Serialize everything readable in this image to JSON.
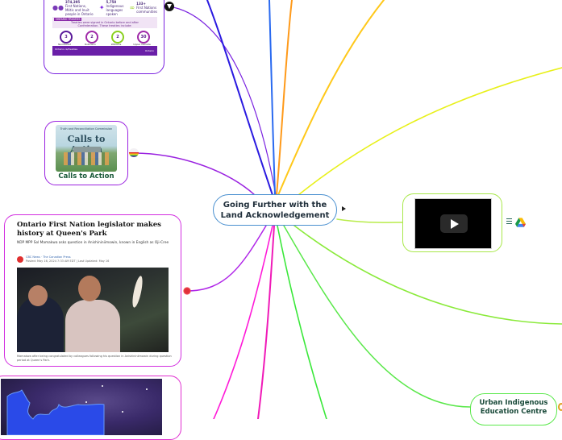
{
  "map": {
    "central_topic": {
      "label": "Going Further with the Land Acknowledgement",
      "line1": "Going Further with the",
      "line2": "Land Acknowledgement",
      "border_color": "#4a90d0"
    },
    "branch_colors": {
      "infographic": "#7a22e0",
      "calls_to_action": "#9a22e0",
      "news": "#d22ee0",
      "turtle": "#e02ed0",
      "video": "#b8ec4a",
      "uiec": "#5ae84a",
      "top_blue_dark": "#2a1ae0",
      "top_blue": "#2a6af0",
      "top_orange": "#ff9a1a",
      "top_amber": "#ffc81a",
      "top_yellow": "#e8f01a",
      "right_green": "#8aea3a",
      "bottom_magenta": "#ff1ad8",
      "bottom_pink": "#f01ab8",
      "bottom_green": "#3ae83a"
    }
  },
  "infographic": {
    "stats": [
      {
        "value": "374,395",
        "caption": "First Nations, Métis and Inuit people in Ontario"
      },
      {
        "value": "5,758",
        "caption": "Indigenous languages spoken"
      },
      {
        "value": "133+",
        "caption": "First Nations communities"
      }
    ],
    "band_tag": "ONTARIO TREATIES",
    "band_text": "Treaties were signed in Ontario before and after Confederation. These treaties include:",
    "circles": [
      {
        "value": "3",
        "label": "Numbered Treaties"
      },
      {
        "value": "2",
        "label": "Robinson Treaties"
      },
      {
        "value": "2",
        "label": "Williams Treaties"
      },
      {
        "value": "30",
        "label": "Upper Canada Treaties"
      }
    ],
    "footer_left": "Ontario.ca/treaties",
    "footer_right": "Ontario"
  },
  "calls_to_action": {
    "image_title": "Calls to Action",
    "image_subtitle": "Truth and Reconciliation Commission",
    "label": "Calls to Action"
  },
  "news": {
    "headline": "Ontario First Nation legislator makes history at Queen's Park",
    "dek": "NDP MPP Sol Mamakwa asks question in Anishininiimowin, known in English as Oji-Cree",
    "byline": "CBC News · The Canadian Press",
    "posted": "Posted: May 16, 2024 7:33 AM EDT | Last Updated: May 16",
    "caption": "Mamakwa after being congratulated by colleagues following his question in Anishininiimowin during question period at Queen's Park."
  },
  "video": {
    "play_label": "Play video"
  },
  "uiec": {
    "line1": "Urban Indigenous",
    "line2": "Education Centre"
  },
  "icons": {
    "expand": "triangle-right",
    "ontario": "ontario-trillium-icon",
    "pride": "progress-pride-icon",
    "cbc": "cbc-gem-icon",
    "notes": "notes-lines-icon",
    "drive": "google-drive-icon"
  }
}
